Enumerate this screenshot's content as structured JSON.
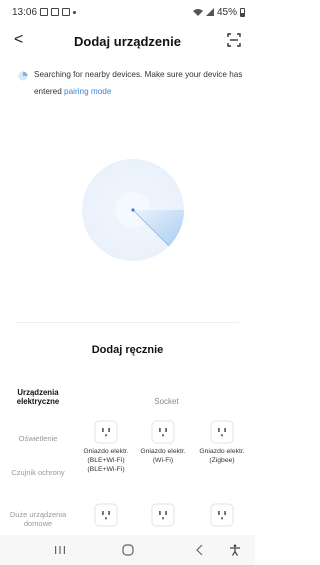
{
  "status_bar": {
    "time": "13:06",
    "battery": "45%"
  },
  "header": {
    "title": "Dodaj urządzenie",
    "back_glyph": "<"
  },
  "searching": {
    "text": "Searching for nearby devices. Make sure your device has entered ",
    "link": "pairing mode"
  },
  "manual": {
    "title": "Dodaj ręcznie"
  },
  "categories": [
    {
      "label": "Urządzenia elektryczne",
      "active": true
    },
    {
      "label": "Oświetlenie",
      "active": false
    },
    {
      "label": "Czujnik ochrony",
      "active": false
    },
    {
      "label": "Duże urządzenia domowe",
      "active": false
    }
  ],
  "section": {
    "label": "Socket"
  },
  "devices": [
    {
      "label": "Gniazdo elektr. (BLE+Wi-Fi) (BLE+Wi-Fi)",
      "icon": "socket-icon"
    },
    {
      "label": "Gniazdo elektr. (Wi-Fi)",
      "icon": "socket-icon"
    },
    {
      "label": "Gniazdo elektr. (Zigbee)",
      "icon": "socket-icon"
    },
    {
      "label": "",
      "icon": "socket-icon"
    },
    {
      "label": "",
      "icon": "socket-icon"
    },
    {
      "label": "",
      "icon": "socket-icon"
    }
  ],
  "nav": {
    "recent_icon": "recent-apps-icon",
    "home_icon": "home-icon",
    "back_icon": "back-icon",
    "accessibility_icon": "accessibility-icon"
  },
  "colors": {
    "accent": "#3a83d9",
    "radar": "#b9d6f5"
  }
}
